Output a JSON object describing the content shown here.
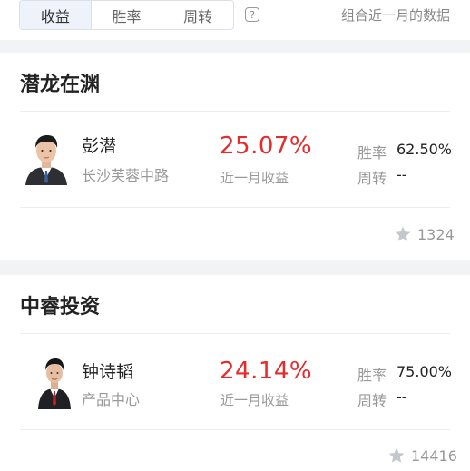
{
  "tabs": [
    {
      "label": "收益",
      "active": true
    },
    {
      "label": "胜率",
      "active": false
    },
    {
      "label": "周转",
      "active": false
    }
  ],
  "help_icon": "question-icon",
  "note": "组合近一月的数据",
  "cards": [
    {
      "title": "潜龙在渊",
      "manager": {
        "name": "彭潜",
        "branch": "长沙芙蓉中路"
      },
      "return_value": "25.07%",
      "return_label": "近一月收益",
      "win_rate_label": "胜率",
      "win_rate": "62.50%",
      "turnover_label": "周转",
      "turnover": "--",
      "followers": "1324"
    },
    {
      "title": "中睿投资",
      "manager": {
        "name": "钟诗韬",
        "branch": "产品中心"
      },
      "return_value": "24.14%",
      "return_label": "近一月收益",
      "win_rate_label": "胜率",
      "win_rate": "75.00%",
      "turnover_label": "周转",
      "turnover": "--",
      "followers": "14416"
    }
  ],
  "colors": {
    "accent_red": "#e52b2b",
    "star_gray": "#c4c7cc"
  },
  "icons": {
    "star": "star-icon",
    "avatar": "avatar-photo"
  }
}
